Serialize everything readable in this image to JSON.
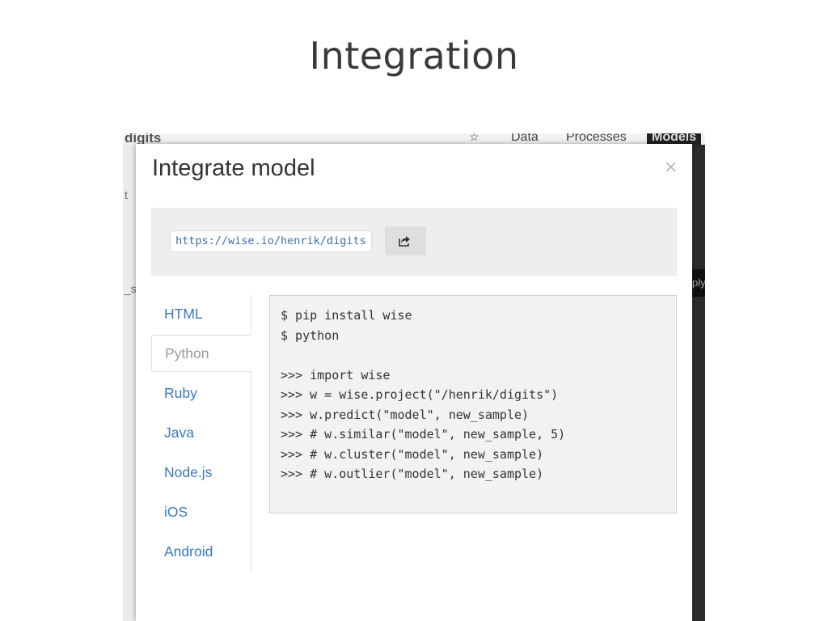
{
  "slide": {
    "title": "Integration"
  },
  "background_app": {
    "title": "digits",
    "star": "☆",
    "nav": [
      "Data",
      "Processes",
      "Models"
    ],
    "left_fragments": [
      "t",
      "_s"
    ],
    "right_fragment": "ply"
  },
  "modal": {
    "title": "Integrate model",
    "close": "×",
    "url": "https://wise.io/henrik/digits",
    "share_icon": "share-arrow-icon",
    "tabs": [
      {
        "label": "HTML",
        "active": false
      },
      {
        "label": "Python",
        "active": true
      },
      {
        "label": "Ruby",
        "active": false
      },
      {
        "label": "Java",
        "active": false
      },
      {
        "label": "Node.js",
        "active": false
      },
      {
        "label": "iOS",
        "active": false
      },
      {
        "label": "Android",
        "active": false
      }
    ],
    "code_lines": [
      "$ pip install wise",
      "$ python",
      "",
      ">>> import wise",
      ">>> w = wise.project(\"/henrik/digits\")",
      ">>> w.predict(\"model\", new_sample)",
      ">>> # w.similar(\"model\", new_sample, 5)",
      ">>> # w.cluster(\"model\", new_sample)",
      ">>> # w.outlier(\"model\", new_sample)"
    ]
  },
  "colors": {
    "link_blue": "#3a78c2",
    "url_text": "#3a6fb0",
    "inactive_tab_text": "#9a9a9a"
  }
}
